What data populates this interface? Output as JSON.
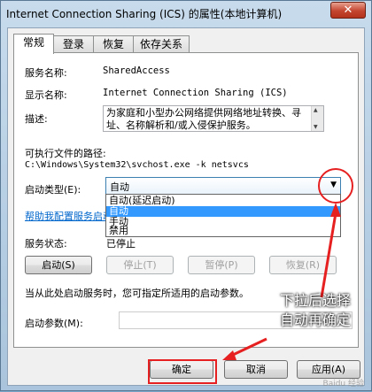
{
  "window": {
    "title": "Internet Connection Sharing (ICS) 的属性(本地计算机)",
    "close_glyph": "✕"
  },
  "tabs": [
    {
      "label": "常规"
    },
    {
      "label": "登录"
    },
    {
      "label": "恢复"
    },
    {
      "label": "依存关系"
    }
  ],
  "general": {
    "service_name_label": "服务名称:",
    "service_name_value": "SharedAccess",
    "display_name_label": "显示名称:",
    "display_name_value": "Internet Connection Sharing (ICS)",
    "description_label": "描述:",
    "description_value": "为家庭和小型办公网络提供网络地址转换、寻址、名称解析和/或入侵保护服务。",
    "exe_path_label": "可执行文件的路径:",
    "exe_path_value": "C:\\Windows\\System32\\svchost.exe -k netsvcs",
    "startup_type_label": "启动类型(E):",
    "startup_type_value": "自动",
    "startup_options": [
      "自动(延迟启动)",
      "自动",
      "手动",
      "禁用"
    ],
    "help_link": "帮助我配置服务启动",
    "status_label": "服务状态:",
    "status_value": "已停止",
    "start_button": "启动(S)",
    "stop_button": "停止(T)",
    "pause_button": "暂停(P)",
    "resume_button": "恢复(R)",
    "hint_text": "当从此处启动服务时，您可指定所适用的启动参数。",
    "params_label": "启动参数(M):",
    "params_value": ""
  },
  "footer": {
    "ok": "确定",
    "cancel": "取消",
    "apply": "应用(A)"
  },
  "annotation": {
    "line1": "下拉后选择",
    "line2": "自动再确定"
  },
  "watermark": "Baidu 经验"
}
